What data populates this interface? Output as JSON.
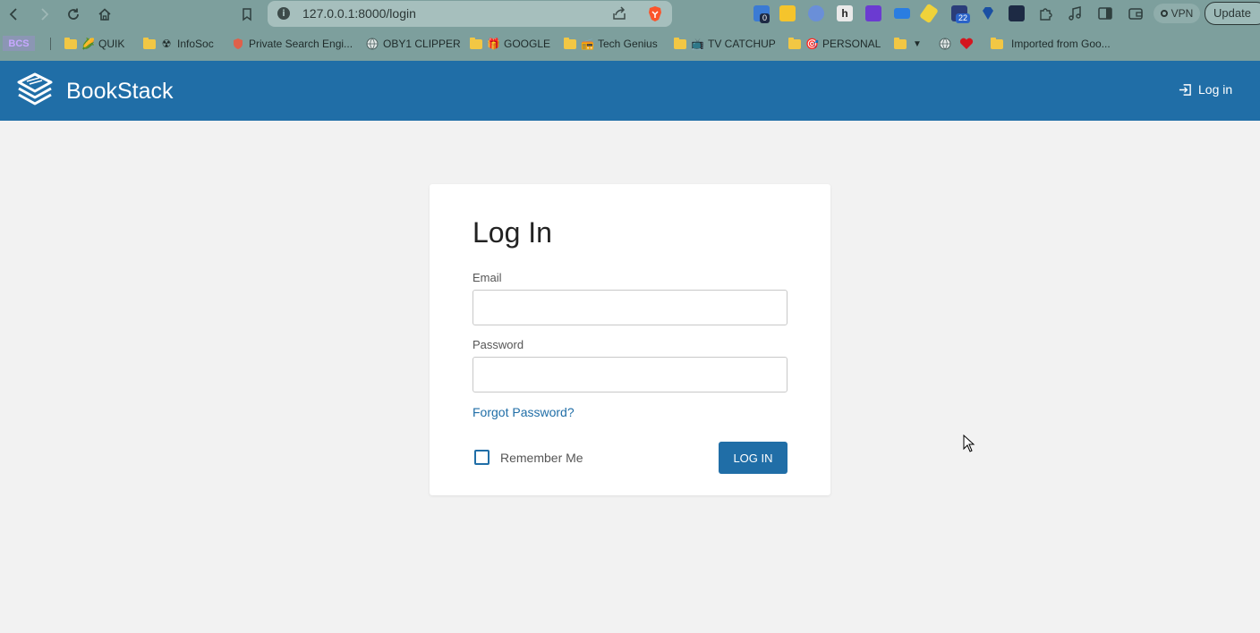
{
  "browser": {
    "url": "127.0.0.1:8000/login",
    "vpn_label": "VPN",
    "update_label": "Update",
    "extension_badges": [
      "0",
      "22"
    ],
    "bookmarks": [
      {
        "label": "BCS",
        "kind": "badge"
      },
      {
        "label": "QUIK",
        "kind": "folder-emoji",
        "glyph": "🌽"
      },
      {
        "label": "InfoSoc",
        "kind": "folder-emoji",
        "glyph": "☢"
      },
      {
        "label": "Private Search Engi...",
        "kind": "site"
      },
      {
        "label": "OBY1 CLIPPER",
        "kind": "globe"
      },
      {
        "label": "GOOGLE",
        "kind": "folder-emoji",
        "glyph": "🎁"
      },
      {
        "label": "Tech Genius",
        "kind": "folder-emoji",
        "glyph": "📻"
      },
      {
        "label": "TV CATCHUP",
        "kind": "folder-emoji",
        "glyph": "📺"
      },
      {
        "label": "PERSONAL",
        "kind": "folder-emoji",
        "glyph": "🎯"
      },
      {
        "label": "",
        "kind": "folder-arrow"
      },
      {
        "label": "",
        "kind": "globe-heart"
      },
      {
        "label": "Imported from Goo...",
        "kind": "folder"
      }
    ]
  },
  "app": {
    "brand": "BookStack",
    "header_login": "Log in",
    "primary_color": "#206ea7"
  },
  "login": {
    "title": "Log In",
    "email_label": "Email",
    "email_value": "",
    "password_label": "Password",
    "password_value": "",
    "forgot_link": "Forgot Password?",
    "remember_label": "Remember Me",
    "remember_checked": false,
    "submit_label": "LOG IN"
  }
}
